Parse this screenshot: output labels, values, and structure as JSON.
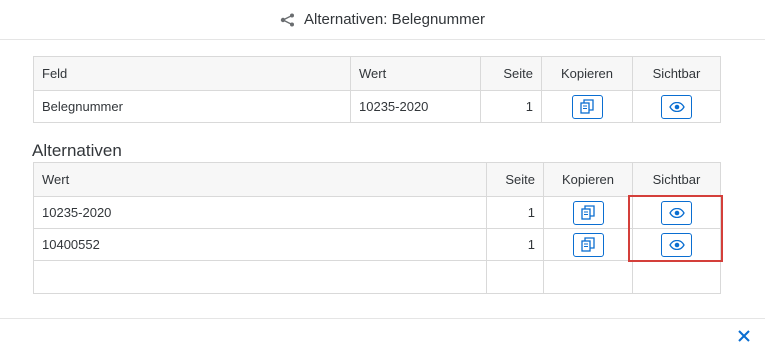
{
  "dialog": {
    "title": "Alternativen: Belegnummer",
    "title_icon": "share-icon"
  },
  "current": {
    "headers": {
      "feld": "Feld",
      "wert": "Wert",
      "seite": "Seite",
      "kopieren": "Kopieren",
      "sichtbar": "Sichtbar"
    },
    "row": {
      "feld": "Belegnummer",
      "wert": "10235-2020",
      "seite": "1"
    }
  },
  "alternatives": {
    "section_title": "Alternativen",
    "headers": {
      "wert": "Wert",
      "seite": "Seite",
      "kopieren": "Kopieren",
      "sichtbar": "Sichtbar"
    },
    "rows": [
      {
        "wert": "10235-2020",
        "seite": "1"
      },
      {
        "wert": "10400552",
        "seite": "1"
      }
    ]
  },
  "footer": {
    "close_icon": "close-icon"
  },
  "colors": {
    "accent": "#0a6ed1",
    "highlight": "#d43f3a"
  }
}
